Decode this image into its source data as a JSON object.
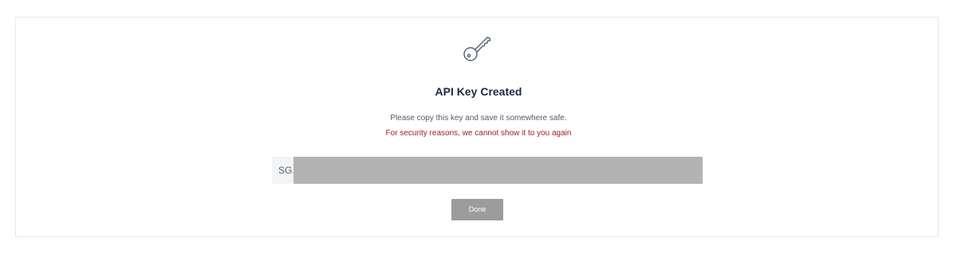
{
  "dialog": {
    "icon": "key-icon",
    "title": "API Key Created",
    "message": "Please copy this key and save it somewhere safe.",
    "warning": "For security reasons, we cannot show it to you again",
    "key_prefix": "SG.",
    "done_label": "Done"
  },
  "colors": {
    "title": "#1b2a44",
    "warning": "#a31d1d",
    "button": "#9c9c9c",
    "redaction": "#b3b3b3"
  }
}
